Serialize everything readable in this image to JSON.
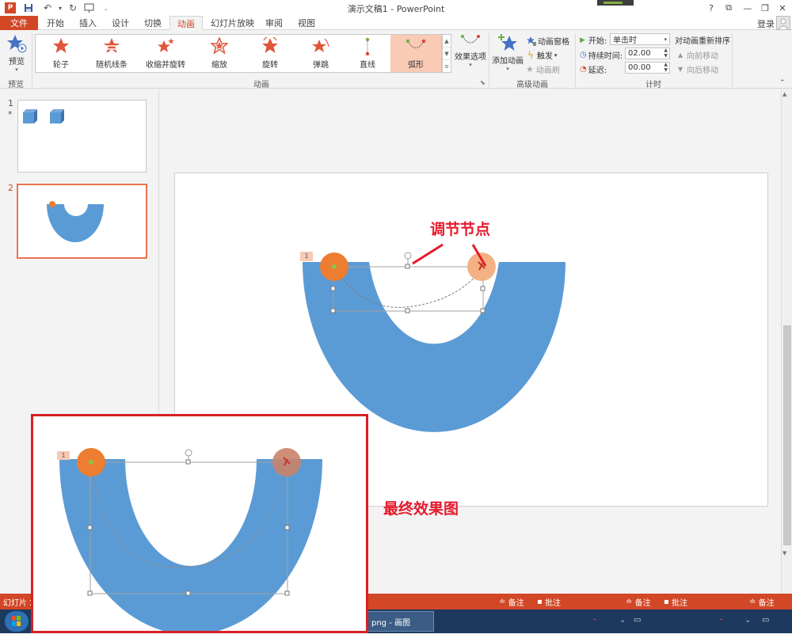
{
  "titlebar": {
    "title": "演示文稿1 - PowerPoint",
    "help": "?",
    "restore_ribbon": "⧉",
    "minimize": "—",
    "maximize": "❐",
    "close": "✕"
  },
  "tabs": [
    "文件",
    "开始",
    "插入",
    "设计",
    "切换",
    "动画",
    "幻灯片放映",
    "审阅",
    "视图"
  ],
  "active_tab": "动画",
  "login": "登录",
  "ribbon": {
    "preview_label": "预览",
    "preview_group": "预览",
    "gallery": [
      {
        "label": "轮子",
        "icon": "wheel-star-icon"
      },
      {
        "label": "随机线条",
        "icon": "random-bars-star-icon"
      },
      {
        "label": "收缩并旋转",
        "icon": "shrink-turn-star-icon"
      },
      {
        "label": "缩放",
        "icon": "zoom-star-icon"
      },
      {
        "label": "旋转",
        "icon": "spin-star-icon"
      },
      {
        "label": "弹跳",
        "icon": "bounce-star-icon"
      },
      {
        "label": "直线",
        "icon": "line-path-icon"
      },
      {
        "label": "弧形",
        "icon": "arc-path-icon"
      }
    ],
    "selected_gallery": "弧形",
    "animation_group": "动画",
    "effect_options": "效果选项",
    "add_animation": "添加动画",
    "animation_pane": "动画窗格",
    "trigger": "触发",
    "animation_painter": "动画刷",
    "advanced_group": "高级动画",
    "start_label": "开始:",
    "start_value": "单击时",
    "duration_label": "持续时间:",
    "duration_value": "02.00",
    "delay_label": "延迟:",
    "delay_value": "00.00",
    "reorder_title": "对动画重新排序",
    "move_earlier": "向前移动",
    "move_later": "向后移动",
    "timing_group": "计时"
  },
  "slides": [
    {
      "num": "1",
      "star": "*"
    },
    {
      "num": "2"
    }
  ],
  "slide": {
    "anim_tag": "1",
    "annotation_node": "调节节点",
    "annotation_final": "最终效果图",
    "inset_tag": "1"
  },
  "status": {
    "left": "幻灯片 2",
    "notes": "备注",
    "comments": "批注"
  },
  "taskbar": {
    "item": "png - 画图"
  },
  "colors": {
    "accent": "#d24726",
    "shape_blue": "#5b9bd5",
    "orange_dot": "#ed7d31",
    "annotation_red": "#e8192c"
  }
}
